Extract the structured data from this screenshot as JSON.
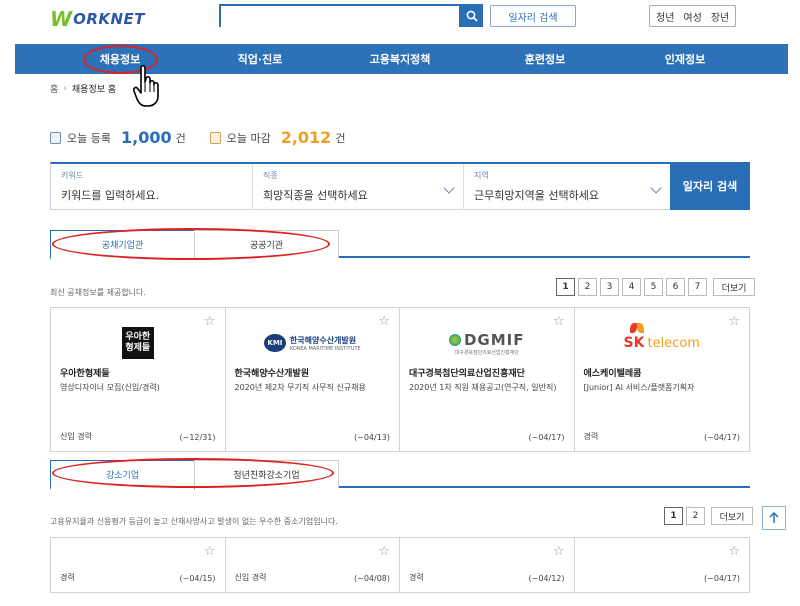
{
  "header": {
    "logo_text": "ORKNET",
    "search_placeholder": "",
    "job_search_label": "일자리 검색",
    "persona": [
      "청년",
      "여성",
      "장년"
    ]
  },
  "nav": [
    "채용정보",
    "직업·진로",
    "고용복지정책",
    "훈련정보",
    "인재정보"
  ],
  "breadcrumb": {
    "home": "홈",
    "current": "채용정보 홈"
  },
  "stats": {
    "today_reg_label": "오늘 등록",
    "today_reg_value": "1,000",
    "today_reg_unit": "건",
    "today_close_label": "오늘 마감",
    "today_close_value": "2,012",
    "today_close_unit": "건"
  },
  "search_panel": {
    "keyword_label": "키워드",
    "keyword_placeholder": "키워드를 입력하세요.",
    "job_label": "직종",
    "job_placeholder": "희망직종을 선택하세요",
    "region_label": "지역",
    "region_placeholder": "근무희망지역을 선택하세요",
    "button": "일자리 검색"
  },
  "section1": {
    "tabs": [
      "공채기업관",
      "공공기관"
    ],
    "desc": "최신 공채정보를 제공합니다.",
    "pages": [
      "1",
      "2",
      "3",
      "4",
      "5",
      "6",
      "7"
    ],
    "more": "더보기",
    "cards": [
      {
        "logo": "우아한 형제들",
        "company": "우아한형제들",
        "title": "영상디자이너 모집(신입/경력)",
        "career": "신입 경력",
        "deadline": "(~12/31)"
      },
      {
        "logo": "한국해양수산개발원",
        "logo_sub": "KOREA MARITIME INSTITUTE",
        "logo_mark": "KMI",
        "company": "한국해양수산개발원",
        "title": "2020년 제2차 무기직 사무직 신규채용",
        "career": "",
        "deadline": "(~04/13)"
      },
      {
        "logo": "DGMIF",
        "logo_sub": "대구경북첨단의료산업진흥재단",
        "company": "대구경북첨단의료산업진흥재단",
        "title": "2020년 1차 직원 채용공고(연구직, 일반직)",
        "career": "",
        "deadline": "(~04/17)"
      },
      {
        "logo_sk": "SK",
        "logo": "telecom",
        "company": "에스케이텔레콤",
        "title": "[Junior] AI 서비스/플랫폼기획자",
        "career": "경력",
        "deadline": "(~04/17)"
      }
    ]
  },
  "section2": {
    "tabs": [
      "강소기업",
      "청년친화강소기업"
    ],
    "desc": "고용유지율과 신용평가 등급이 높고 산재사망사고 발생이 없는 우수한 중소기업입니다.",
    "pages": [
      "1",
      "2"
    ],
    "more": "더보기",
    "cards": [
      {
        "career": "경력",
        "deadline": "(~04/15)"
      },
      {
        "career": "신입 경력",
        "deadline": "(~04/08)"
      },
      {
        "career": "경력",
        "deadline": "(~04/12)"
      },
      {
        "career": "",
        "deadline": "(~04/17)"
      }
    ]
  },
  "colors": {
    "primary": "#2a6eb8",
    "nav": "#2d72b8",
    "accent_orange": "#f0a020",
    "annotation_red": "#d22222"
  }
}
